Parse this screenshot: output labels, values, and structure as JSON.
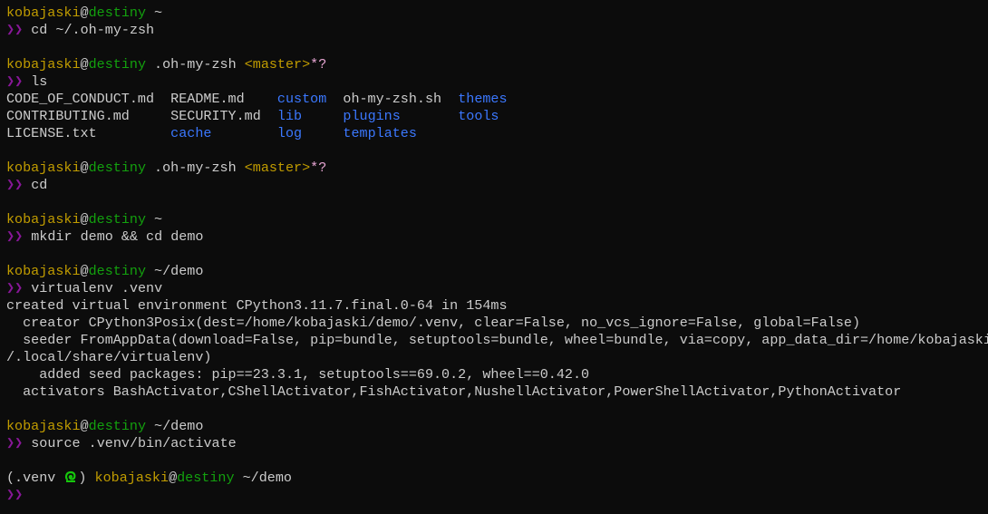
{
  "colors": {
    "background": "#0c0c0c",
    "user": "#c19c00",
    "host": "#13a10e",
    "prompt": "#881798",
    "directory": "#3b78ff",
    "text": "#cccccc",
    "venv_icon": "#16c60c"
  },
  "lines": [
    [
      [
        "kobajaski",
        "user"
      ],
      [
        "@",
        "at"
      ],
      [
        "destiny",
        "host"
      ],
      [
        " ~",
        "path"
      ]
    ],
    [
      [
        "❯❯",
        "prompt"
      ],
      [
        " cd ~/.oh-my-zsh",
        "text"
      ]
    ],
    [],
    [
      [
        "kobajaski",
        "user"
      ],
      [
        "@",
        "at"
      ],
      [
        "destiny",
        "host"
      ],
      [
        " .oh-my-zsh ",
        "path"
      ],
      [
        "<master>",
        "git"
      ],
      [
        "*?",
        "dirty"
      ]
    ],
    [
      [
        "❯❯",
        "prompt"
      ],
      [
        " ls",
        "text"
      ]
    ],
    [
      [
        "CODE_OF_CONDUCT.md  README.md    ",
        "text"
      ],
      [
        "custom",
        "dir"
      ],
      [
        "  oh-my-zsh.sh  ",
        "text"
      ],
      [
        "themes",
        "dir"
      ]
    ],
    [
      [
        "CONTRIBUTING.md     SECURITY.md  ",
        "text"
      ],
      [
        "lib",
        "dir"
      ],
      [
        "     ",
        "text"
      ],
      [
        "plugins",
        "dir"
      ],
      [
        "       ",
        "text"
      ],
      [
        "tools",
        "dir"
      ]
    ],
    [
      [
        "LICENSE.txt         ",
        "text"
      ],
      [
        "cache",
        "dir"
      ],
      [
        "        ",
        "text"
      ],
      [
        "log",
        "dir"
      ],
      [
        "     ",
        "text"
      ],
      [
        "templates",
        "dir"
      ]
    ],
    [],
    [
      [
        "kobajaski",
        "user"
      ],
      [
        "@",
        "at"
      ],
      [
        "destiny",
        "host"
      ],
      [
        " .oh-my-zsh ",
        "path"
      ],
      [
        "<master>",
        "git"
      ],
      [
        "*?",
        "dirty"
      ]
    ],
    [
      [
        "❯❯",
        "prompt"
      ],
      [
        " cd",
        "text"
      ]
    ],
    [],
    [
      [
        "kobajaski",
        "user"
      ],
      [
        "@",
        "at"
      ],
      [
        "destiny",
        "host"
      ],
      [
        " ~",
        "path"
      ]
    ],
    [
      [
        "❯❯",
        "prompt"
      ],
      [
        " mkdir demo && cd demo",
        "text"
      ]
    ],
    [],
    [
      [
        "kobajaski",
        "user"
      ],
      [
        "@",
        "at"
      ],
      [
        "destiny",
        "host"
      ],
      [
        " ~/demo",
        "path"
      ]
    ],
    [
      [
        "❯❯",
        "prompt"
      ],
      [
        " virtualenv .venv",
        "text"
      ]
    ],
    [
      [
        "created virtual environment CPython3.11.7.final.0-64 in 154ms",
        "text"
      ]
    ],
    [
      [
        "  creator CPython3Posix(dest=/home/kobajaski/demo/.venv, clear=False, no_vcs_ignore=False, global=False)",
        "text"
      ]
    ],
    [
      [
        "  seeder FromAppData(download=False, pip=bundle, setuptools=bundle, wheel=bundle, via=copy, app_data_dir=/home/kobajaski",
        "text"
      ]
    ],
    [
      [
        "/.local/share/virtualenv)",
        "text"
      ]
    ],
    [
      [
        "    added seed packages: pip==23.3.1, setuptools==69.0.2, wheel==0.42.0",
        "text"
      ]
    ],
    [
      [
        "  activators BashActivator,CShellActivator,FishActivator,NushellActivator,PowerShellActivator,PythonActivator",
        "text"
      ]
    ],
    [],
    [
      [
        "kobajaski",
        "user"
      ],
      [
        "@",
        "at"
      ],
      [
        "destiny",
        "host"
      ],
      [
        " ~/demo",
        "path"
      ]
    ],
    [
      [
        "❯❯",
        "prompt"
      ],
      [
        " source .venv/bin/activate",
        "text"
      ]
    ],
    [],
    [
      [
        "(.venv ",
        "text"
      ],
      [
        "@icon:python-venv",
        ""
      ],
      [
        ") ",
        "text"
      ],
      [
        "kobajaski",
        "user"
      ],
      [
        "@",
        "at"
      ],
      [
        "destiny",
        "host"
      ],
      [
        " ~/demo",
        "path"
      ]
    ],
    [
      [
        "❯❯",
        "prompt"
      ]
    ]
  ]
}
